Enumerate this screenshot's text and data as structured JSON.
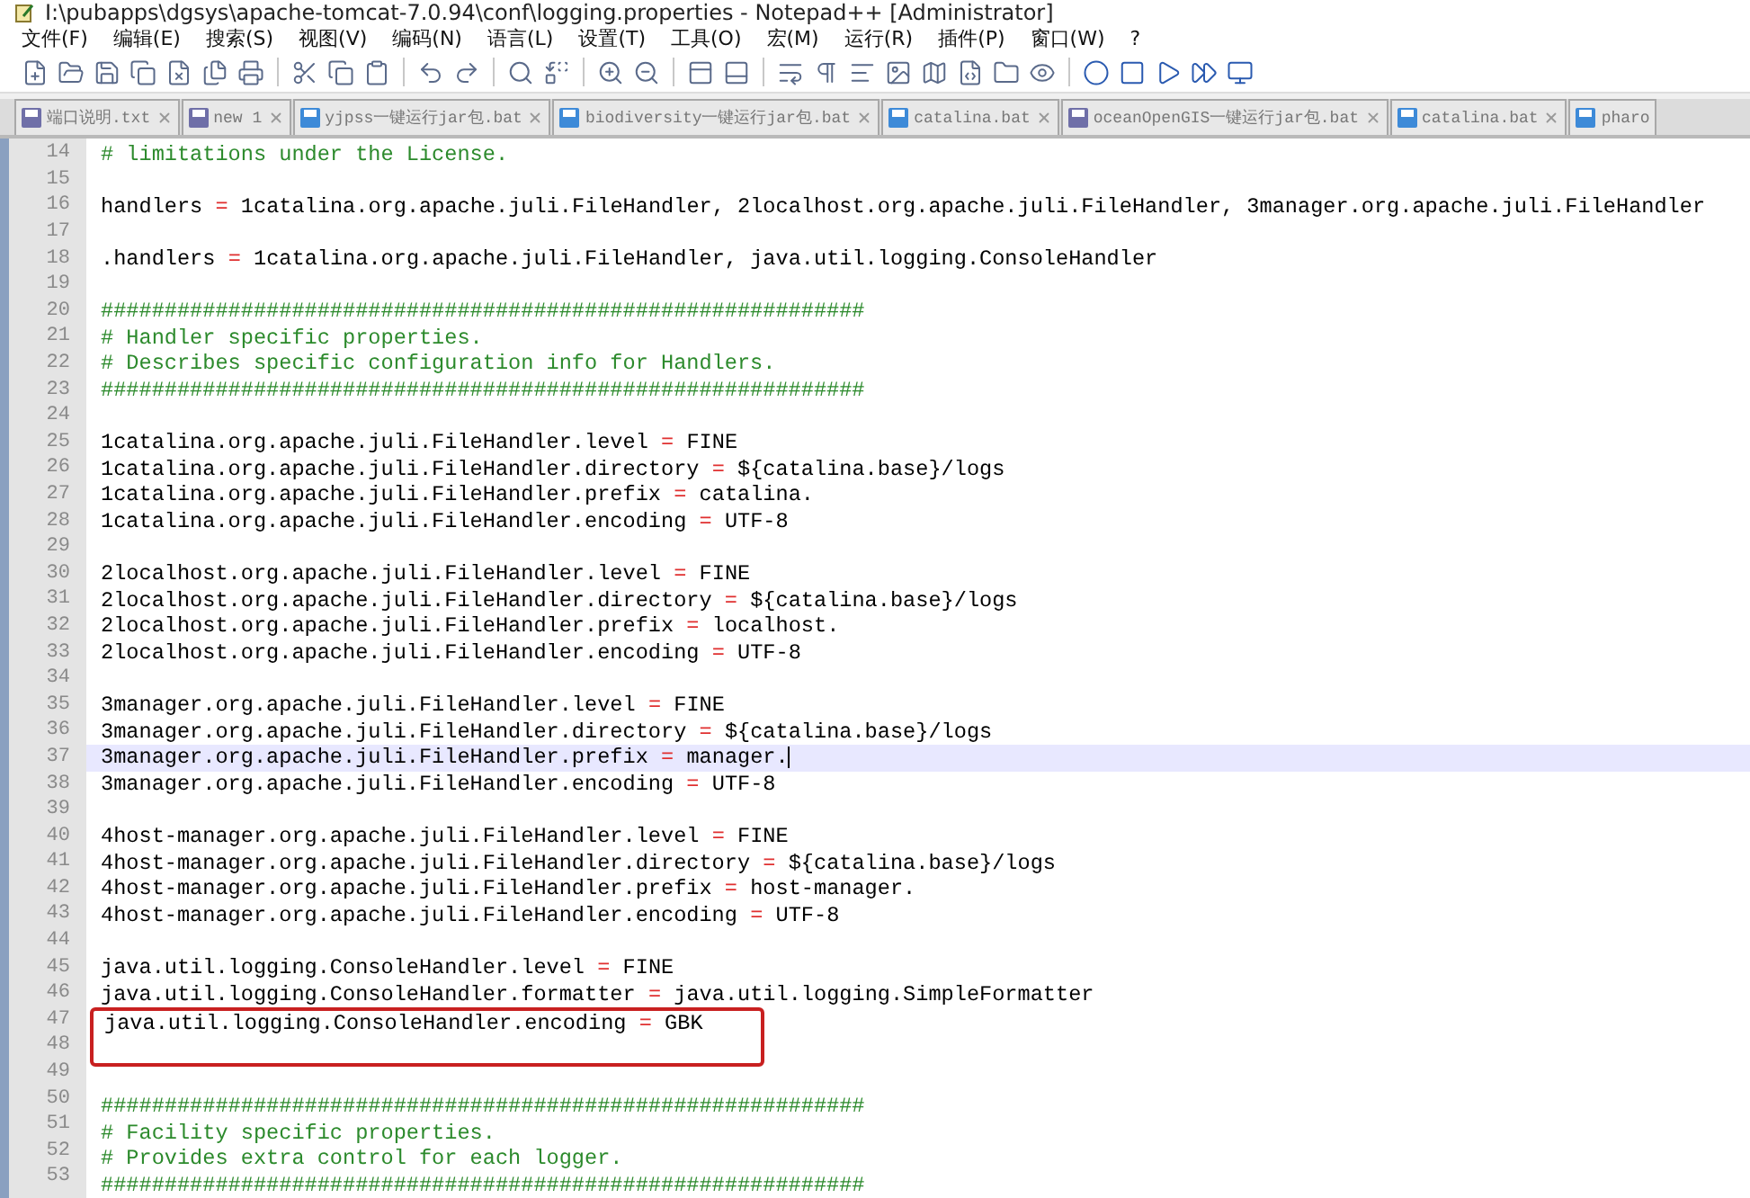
{
  "window": {
    "title": "I:\\pubapps\\dgsys\\apache-tomcat-7.0.94\\conf\\logging.properties - Notepad++ [Administrator]"
  },
  "menu": [
    "文件(F)",
    "编辑(E)",
    "搜索(S)",
    "视图(V)",
    "编码(N)",
    "语言(L)",
    "设置(T)",
    "工具(O)",
    "宏(M)",
    "运行(R)",
    "插件(P)",
    "窗口(W)",
    "?"
  ],
  "tabs": [
    {
      "label": "端口说明.txt",
      "selected": false,
      "color": "#6f6fa8"
    },
    {
      "label": "new 1",
      "selected": false,
      "color": "#6f6fa8"
    },
    {
      "label": "yjpss一键运行jar包.bat",
      "selected": false,
      "color": "#3d8ad8"
    },
    {
      "label": "biodiversity一键运行jar包.bat",
      "selected": false,
      "color": "#3d8ad8"
    },
    {
      "label": "catalina.bat",
      "selected": false,
      "color": "#3d8ad8"
    },
    {
      "label": "oceanOpenGIS一键运行jar包.bat",
      "selected": false,
      "color": "#6f6fa8"
    },
    {
      "label": "catalina.bat",
      "selected": false,
      "color": "#3d8ad8"
    },
    {
      "label": "pharo",
      "selected": false,
      "color": "#3d8ad8"
    }
  ],
  "editor": {
    "lines": [
      {
        "no": "14",
        "kind": "comment",
        "text": "# limitations under the License.",
        "current": false
      },
      {
        "no": "15",
        "kind": "blank",
        "current": false
      },
      {
        "no": "16",
        "kind": "property",
        "key": "handlers",
        "op": "=",
        "value": "1catalina.org.apache.juli.FileHandler, 2localhost.org.apache.juli.FileHandler, 3manager.org.apache.juli.FileHandler",
        "current": false
      },
      {
        "no": "17",
        "kind": "blank",
        "current": false
      },
      {
        "no": "18",
        "kind": "property",
        "key": ".handlers",
        "op": "=",
        "value": "1catalina.org.apache.juli.FileHandler, java.util.logging.ConsoleHandler",
        "current": false
      },
      {
        "no": "19",
        "kind": "blank",
        "current": false
      },
      {
        "no": "20",
        "kind": "comment",
        "text": "############################################################",
        "current": false
      },
      {
        "no": "21",
        "kind": "comment",
        "text": "# Handler specific properties.",
        "current": false
      },
      {
        "no": "22",
        "kind": "comment",
        "text": "# Describes specific configuration info for Handlers.",
        "current": false
      },
      {
        "no": "23",
        "kind": "comment",
        "text": "############################################################",
        "current": false
      },
      {
        "no": "24",
        "kind": "blank",
        "current": false
      },
      {
        "no": "25",
        "kind": "property",
        "key": "1catalina.org.apache.juli.FileHandler.level",
        "op": "=",
        "value": "FINE",
        "current": false
      },
      {
        "no": "26",
        "kind": "property",
        "key": "1catalina.org.apache.juli.FileHandler.directory",
        "op": "=",
        "value": "${catalina.base}/logs",
        "current": false
      },
      {
        "no": "27",
        "kind": "property",
        "key": "1catalina.org.apache.juli.FileHandler.prefix",
        "op": "=",
        "value": "catalina.",
        "current": false
      },
      {
        "no": "28",
        "kind": "property",
        "key": "1catalina.org.apache.juli.FileHandler.encoding",
        "op": "=",
        "value": "UTF-8",
        "current": false
      },
      {
        "no": "29",
        "kind": "blank",
        "current": false
      },
      {
        "no": "30",
        "kind": "property",
        "key": "2localhost.org.apache.juli.FileHandler.level",
        "op": "=",
        "value": "FINE",
        "current": false
      },
      {
        "no": "31",
        "kind": "property",
        "key": "2localhost.org.apache.juli.FileHandler.directory",
        "op": "=",
        "value": "${catalina.base}/logs",
        "current": false
      },
      {
        "no": "32",
        "kind": "property",
        "key": "2localhost.org.apache.juli.FileHandler.prefix",
        "op": "=",
        "value": "localhost.",
        "current": false
      },
      {
        "no": "33",
        "kind": "property",
        "key": "2localhost.org.apache.juli.FileHandler.encoding",
        "op": "=",
        "value": "UTF-8",
        "current": false
      },
      {
        "no": "34",
        "kind": "blank",
        "current": false
      },
      {
        "no": "35",
        "kind": "property",
        "key": "3manager.org.apache.juli.FileHandler.level",
        "op": "=",
        "value": "FINE",
        "current": false
      },
      {
        "no": "36",
        "kind": "property",
        "key": "3manager.org.apache.juli.FileHandler.directory",
        "op": "=",
        "value": "${catalina.base}/logs",
        "current": false
      },
      {
        "no": "37",
        "kind": "property",
        "key": "3manager.org.apache.juli.FileHandler.prefix",
        "op": "=",
        "value": "manager.",
        "current": true
      },
      {
        "no": "38",
        "kind": "property",
        "key": "3manager.org.apache.juli.FileHandler.encoding",
        "op": "=",
        "value": "UTF-8",
        "current": false
      },
      {
        "no": "39",
        "kind": "blank",
        "current": false
      },
      {
        "no": "40",
        "kind": "property",
        "key": "4host-manager.org.apache.juli.FileHandler.level",
        "op": "=",
        "value": "FINE",
        "current": false
      },
      {
        "no": "41",
        "kind": "property",
        "key": "4host-manager.org.apache.juli.FileHandler.directory",
        "op": "=",
        "value": "${catalina.base}/logs",
        "current": false
      },
      {
        "no": "42",
        "kind": "property",
        "key": "4host-manager.org.apache.juli.FileHandler.prefix",
        "op": "=",
        "value": "host-manager.",
        "current": false
      },
      {
        "no": "43",
        "kind": "property",
        "key": "4host-manager.org.apache.juli.FileHandler.encoding",
        "op": "=",
        "value": "UTF-8",
        "current": false
      },
      {
        "no": "44",
        "kind": "blank",
        "current": false
      },
      {
        "no": "45",
        "kind": "property",
        "key": "java.util.logging.ConsoleHandler.level",
        "op": "=",
        "value": "FINE",
        "current": false
      },
      {
        "no": "46",
        "kind": "property",
        "key": "java.util.logging.ConsoleHandler.formatter",
        "op": "=",
        "value": "java.util.logging.SimpleFormatter",
        "current": false
      },
      {
        "kind": "boxed",
        "lines": [
          {
            "no": "47",
            "kind": "property",
            "key": "java.util.logging.ConsoleHandler.encoding",
            "op": "=",
            "value": "GBK",
            "current": false
          },
          {
            "no": "48",
            "kind": "blank",
            "current": false
          }
        ]
      },
      {
        "no": "49",
        "kind": "blank",
        "current": false
      },
      {
        "no": "50",
        "kind": "comment",
        "text": "############################################################",
        "current": false
      },
      {
        "no": "51",
        "kind": "comment",
        "text": "# Facility specific properties.",
        "current": false
      },
      {
        "no": "52",
        "kind": "comment",
        "text": "# Provides extra control for each logger.",
        "current": false
      },
      {
        "no": "53",
        "kind": "comment",
        "text": "############################################################",
        "current": false
      }
    ]
  }
}
